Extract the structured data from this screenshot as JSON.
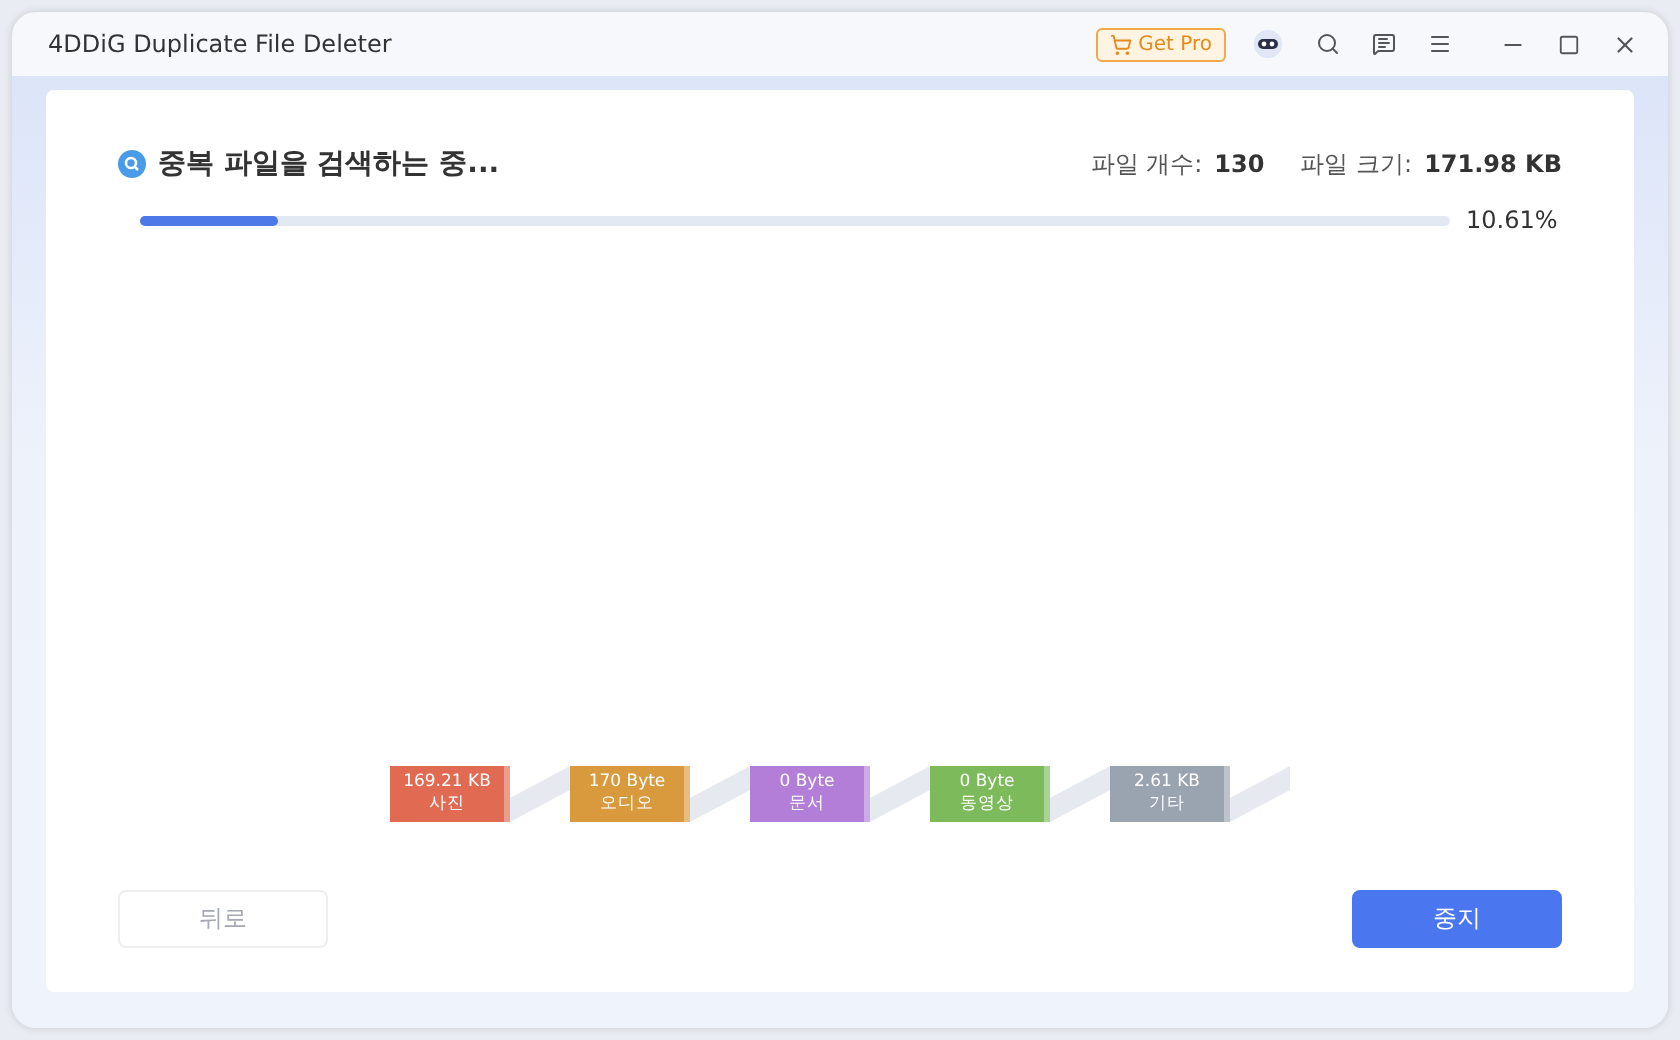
{
  "window": {
    "title": "4DDiG Duplicate File Deleter",
    "get_pro": "Get Pro"
  },
  "scan": {
    "status": "중복 파일을 검색하는 중...",
    "count_label": "파일 개수:",
    "count": "130",
    "size_label": "파일 크기:",
    "size": "171.98 KB",
    "level": 0.1061,
    "percent": "10.61%"
  },
  "categories": [
    {
      "size": "169.21 KB",
      "name": "사진",
      "color": "#e06a52"
    },
    {
      "size": "170 Byte",
      "name": "오디오",
      "color": "#d89a3c"
    },
    {
      "size": "0 Byte",
      "name": "문서",
      "color": "#b37ed8"
    },
    {
      "size": "0 Byte",
      "name": "동영상",
      "color": "#7cba5c"
    },
    {
      "size": "2.61 KB",
      "name": "기타",
      "color": "#9aa3b0"
    }
  ],
  "buttons": {
    "back": {
      "label": "뒤로",
      "disabled": true
    },
    "stop": {
      "label": "중지",
      "disabled": false
    }
  }
}
